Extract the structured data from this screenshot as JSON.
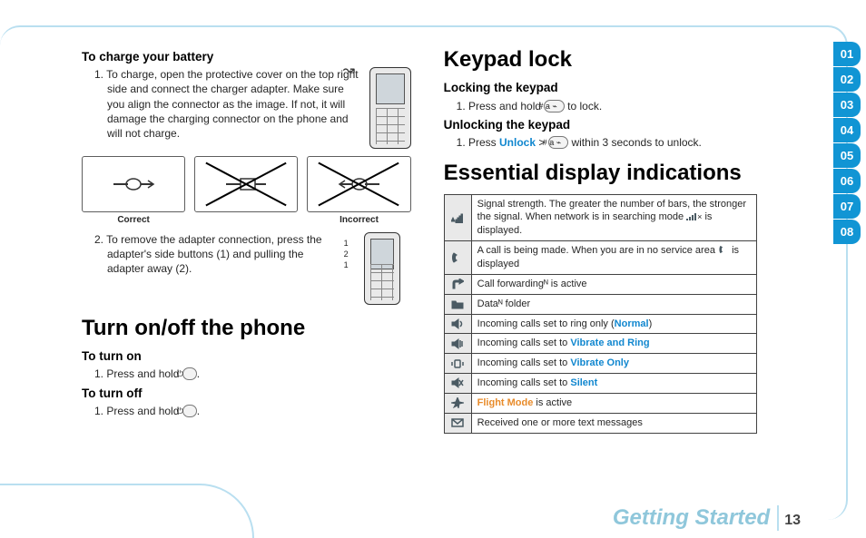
{
  "section_footer": "Getting Started",
  "page_number": "13",
  "tabs": [
    "01",
    "02",
    "03",
    "04",
    "05",
    "06",
    "07",
    "08"
  ],
  "tabs_dim_from": 8,
  "left": {
    "charge": {
      "heading": "To charge your battery",
      "step1_num": "1. ",
      "step1": "To charge, open the protective cover on the top right side and connect the charger adapter. Make sure you align the connector as the image. If not, it will damage the charging connector on the phone and will not charge.",
      "correct": "Correct",
      "incorrect": "Incorrect",
      "step2_num": "2. ",
      "step2": "To remove the adapter connection, press the adapter's side buttons (1) and pulling the adapter away (2).",
      "pnums": "1\n2\n1"
    },
    "power": {
      "title": "Turn on/off the phone",
      "on_h": "To turn on",
      "on_num": "1. ",
      "on_txt_a": "Press and hold ",
      "on_key": "⏻",
      "on_txt_b": ".",
      "off_h": "To turn off",
      "off_num": "1. ",
      "off_txt_a": "Press and hold ",
      "off_key": "⏻",
      "off_txt_b": "."
    }
  },
  "right": {
    "keypad": {
      "title": "Keypad lock",
      "lock_h": "Locking the keypad",
      "lock_num": "1. ",
      "lock_a": "Press and hold ",
      "lock_key": "# a ⌁",
      "lock_b": " to lock.",
      "unlock_h": "Unlocking the keypad",
      "unlock_num": "1. ",
      "unlock_a": "Press ",
      "unlock_link": "Unlock",
      "unlock_b": " > ",
      "unlock_key": "# a ⌁",
      "unlock_c": " within 3 seconds to unlock."
    },
    "display": {
      "title": "Essential display indications",
      "rows": [
        {
          "icon": "signal",
          "txt_a": "Signal strength. The greater the number of bars, the stronger the signal. When network is in searching mode ",
          "txt_b": " is displayed."
        },
        {
          "icon": "call",
          "txt_a": "A call is being made. When you are in no service area ",
          "txt_b": " is displayed"
        },
        {
          "icon": "fwd",
          "txt": "Call forwardingᴺ is active"
        },
        {
          "icon": "folder",
          "txt": "Dataᴺ folder"
        },
        {
          "icon": "spk",
          "txt_a": "Incoming calls set to ring only (",
          "link": "Normal",
          "txt_b": ")"
        },
        {
          "icon": "spkvib",
          "txt_a": "Incoming calls set to ",
          "link": "Vibrate and Ring"
        },
        {
          "icon": "vib",
          "txt_a": "Incoming calls set to ",
          "link": "Vibrate Only"
        },
        {
          "icon": "mute",
          "txt_a": "Incoming calls set to ",
          "link": "Silent"
        },
        {
          "icon": "plane",
          "link": "Flight Mode",
          "txt_b": " is active"
        },
        {
          "icon": "msg",
          "txt": "Received one or more text messages"
        }
      ]
    }
  }
}
